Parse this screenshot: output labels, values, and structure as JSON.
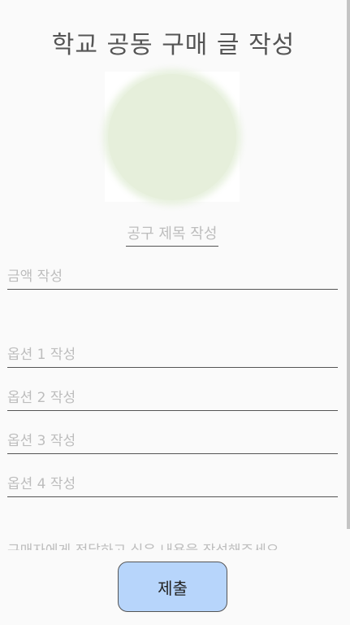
{
  "page": {
    "title": "학교 공동 구매 글 작성"
  },
  "form": {
    "image_placeholder": "image-placeholder",
    "title_placeholder": "공구 제목 작성",
    "price_placeholder": "금액 작성",
    "options": [
      {
        "placeholder": "옵션 1 작성"
      },
      {
        "placeholder": "옵션 2 작성"
      },
      {
        "placeholder": "옵션 3 작성"
      },
      {
        "placeholder": "옵션 4 작성"
      }
    ],
    "description_placeholder": "구매자에게 전달하고 싶은 내용을 작성해주세요",
    "submit_label": "제출"
  },
  "colors": {
    "submit_button": "#b7d5fb",
    "image_circle": "#e6efdb",
    "title_text": "#555555",
    "placeholder_text": "#bdbdbd"
  }
}
